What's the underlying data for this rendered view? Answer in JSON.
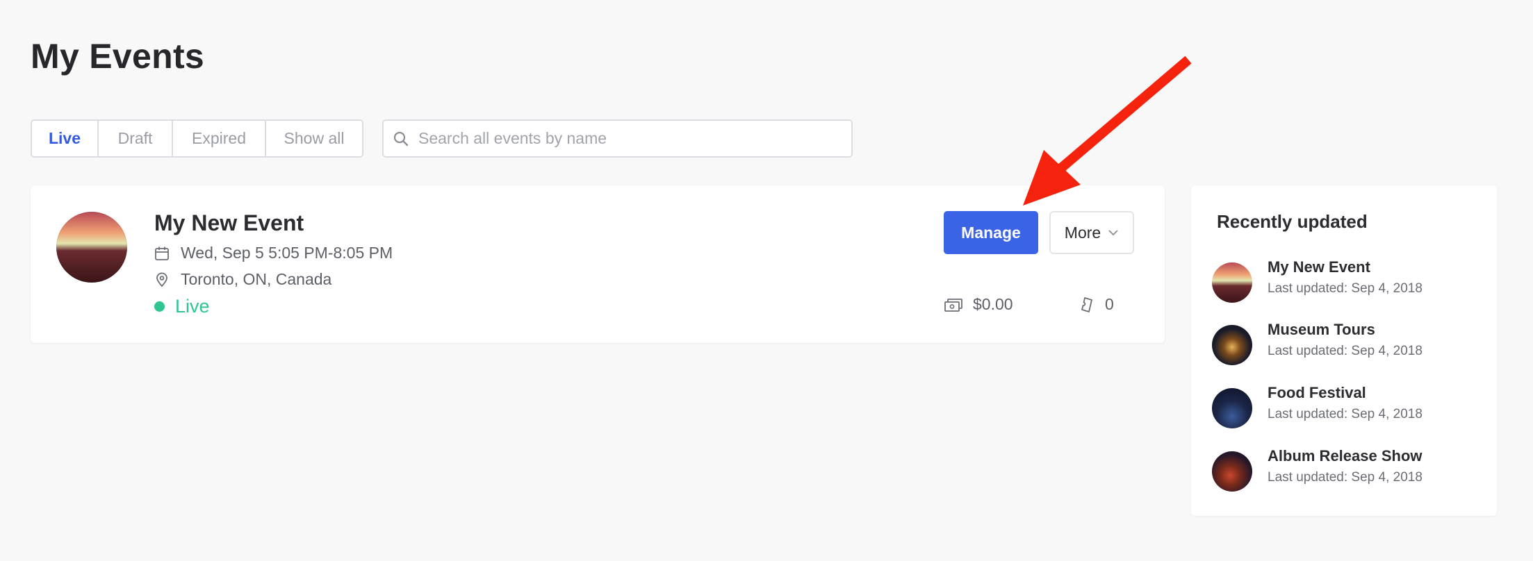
{
  "page": {
    "title": "My Events"
  },
  "filters": {
    "tabs": [
      {
        "label": "Live",
        "active": true
      },
      {
        "label": "Draft",
        "active": false
      },
      {
        "label": "Expired",
        "active": false
      },
      {
        "label": "Show all",
        "active": false
      }
    ]
  },
  "search": {
    "placeholder": "Search all events by name",
    "value": ""
  },
  "event": {
    "name": "My New Event",
    "date": "Wed, Sep 5 5:05 PM-8:05 PM",
    "location": "Toronto, ON, Canada",
    "status": "Live",
    "status_color": "#2fc58f",
    "manage_label": "Manage",
    "more_label": "More",
    "revenue": "$0.00",
    "tickets_sold": "0",
    "icons": [
      "calendar-icon",
      "location-pin-icon",
      "money-icon",
      "ticket-icon",
      "chevron-down-icon"
    ]
  },
  "recent": {
    "title": "Recently updated",
    "items": [
      {
        "name": "My New Event",
        "updated": "Last updated: Sep 4, 2018"
      },
      {
        "name": "Museum Tours",
        "updated": "Last updated: Sep 4, 2018"
      },
      {
        "name": "Food Festival",
        "updated": "Last updated: Sep 4, 2018"
      },
      {
        "name": "Album Release Show",
        "updated": "Last updated: Sep 4, 2018"
      }
    ]
  },
  "colors": {
    "accent": "#3b63e6",
    "annotation_arrow": "#f5230d"
  }
}
